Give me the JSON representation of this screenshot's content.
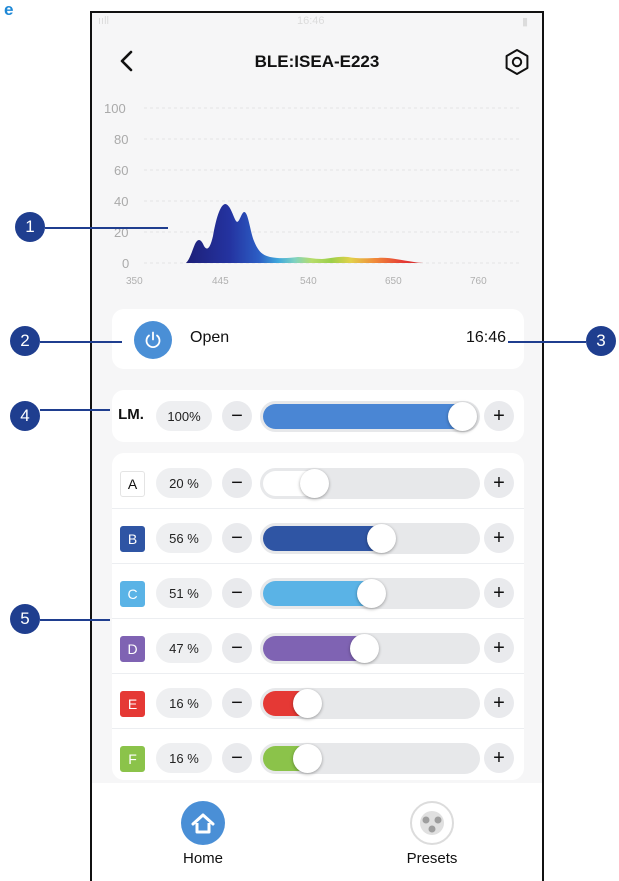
{
  "figure_letter": "e",
  "header": {
    "title": "BLE:ISEA-E223"
  },
  "status_bar": {
    "signal": "ııll",
    "clock": "16:46",
    "battery": "▮"
  },
  "spectrum": {
    "y_ticks": [
      "100",
      "80",
      "60",
      "40",
      "20",
      "0"
    ],
    "x_ticks": [
      "350",
      "445",
      "540",
      "650",
      "760"
    ]
  },
  "power": {
    "label": "Open",
    "time": "16:46"
  },
  "lm": {
    "label": "LM.",
    "percent": "100%",
    "value": 1.0,
    "color": "#4a86d4"
  },
  "channels": [
    {
      "label": "A",
      "percent": "20 %",
      "value": 0.2,
      "color": "#ffffff",
      "chip_text": "#111111",
      "chip_border": "#e4e4e4"
    },
    {
      "label": "B",
      "percent": "56 %",
      "value": 0.56,
      "color": "#2f55a4",
      "chip_text": "#ffffff",
      "chip_border": "#2f55a4"
    },
    {
      "label": "C",
      "percent": "51 %",
      "value": 0.51,
      "color": "#5ab3e6",
      "chip_text": "#ffffff",
      "chip_border": "#5ab3e6"
    },
    {
      "label": "D",
      "percent": "47 %",
      "value": 0.47,
      "color": "#7f63b3",
      "chip_text": "#ffffff",
      "chip_border": "#7f63b3"
    },
    {
      "label": "E",
      "percent": "16 %",
      "value": 0.16,
      "color": "#e53935",
      "chip_text": "#ffffff",
      "chip_border": "#e53935"
    },
    {
      "label": "F",
      "percent": "16 %",
      "value": 0.16,
      "color": "#8bc34a",
      "chip_text": "#ffffff",
      "chip_border": "#8bc34a"
    }
  ],
  "controls": {
    "minus": "−",
    "plus": "+"
  },
  "bottom_nav": [
    {
      "label": "Home",
      "icon": "home-icon",
      "active": true
    },
    {
      "label": "Presets",
      "icon": "presets-icon",
      "active": false
    }
  ],
  "callouts": [
    "1",
    "2",
    "3",
    "4",
    "5"
  ],
  "colors": {
    "accent": "#4a8fd6",
    "callout": "#1f3e8f"
  }
}
